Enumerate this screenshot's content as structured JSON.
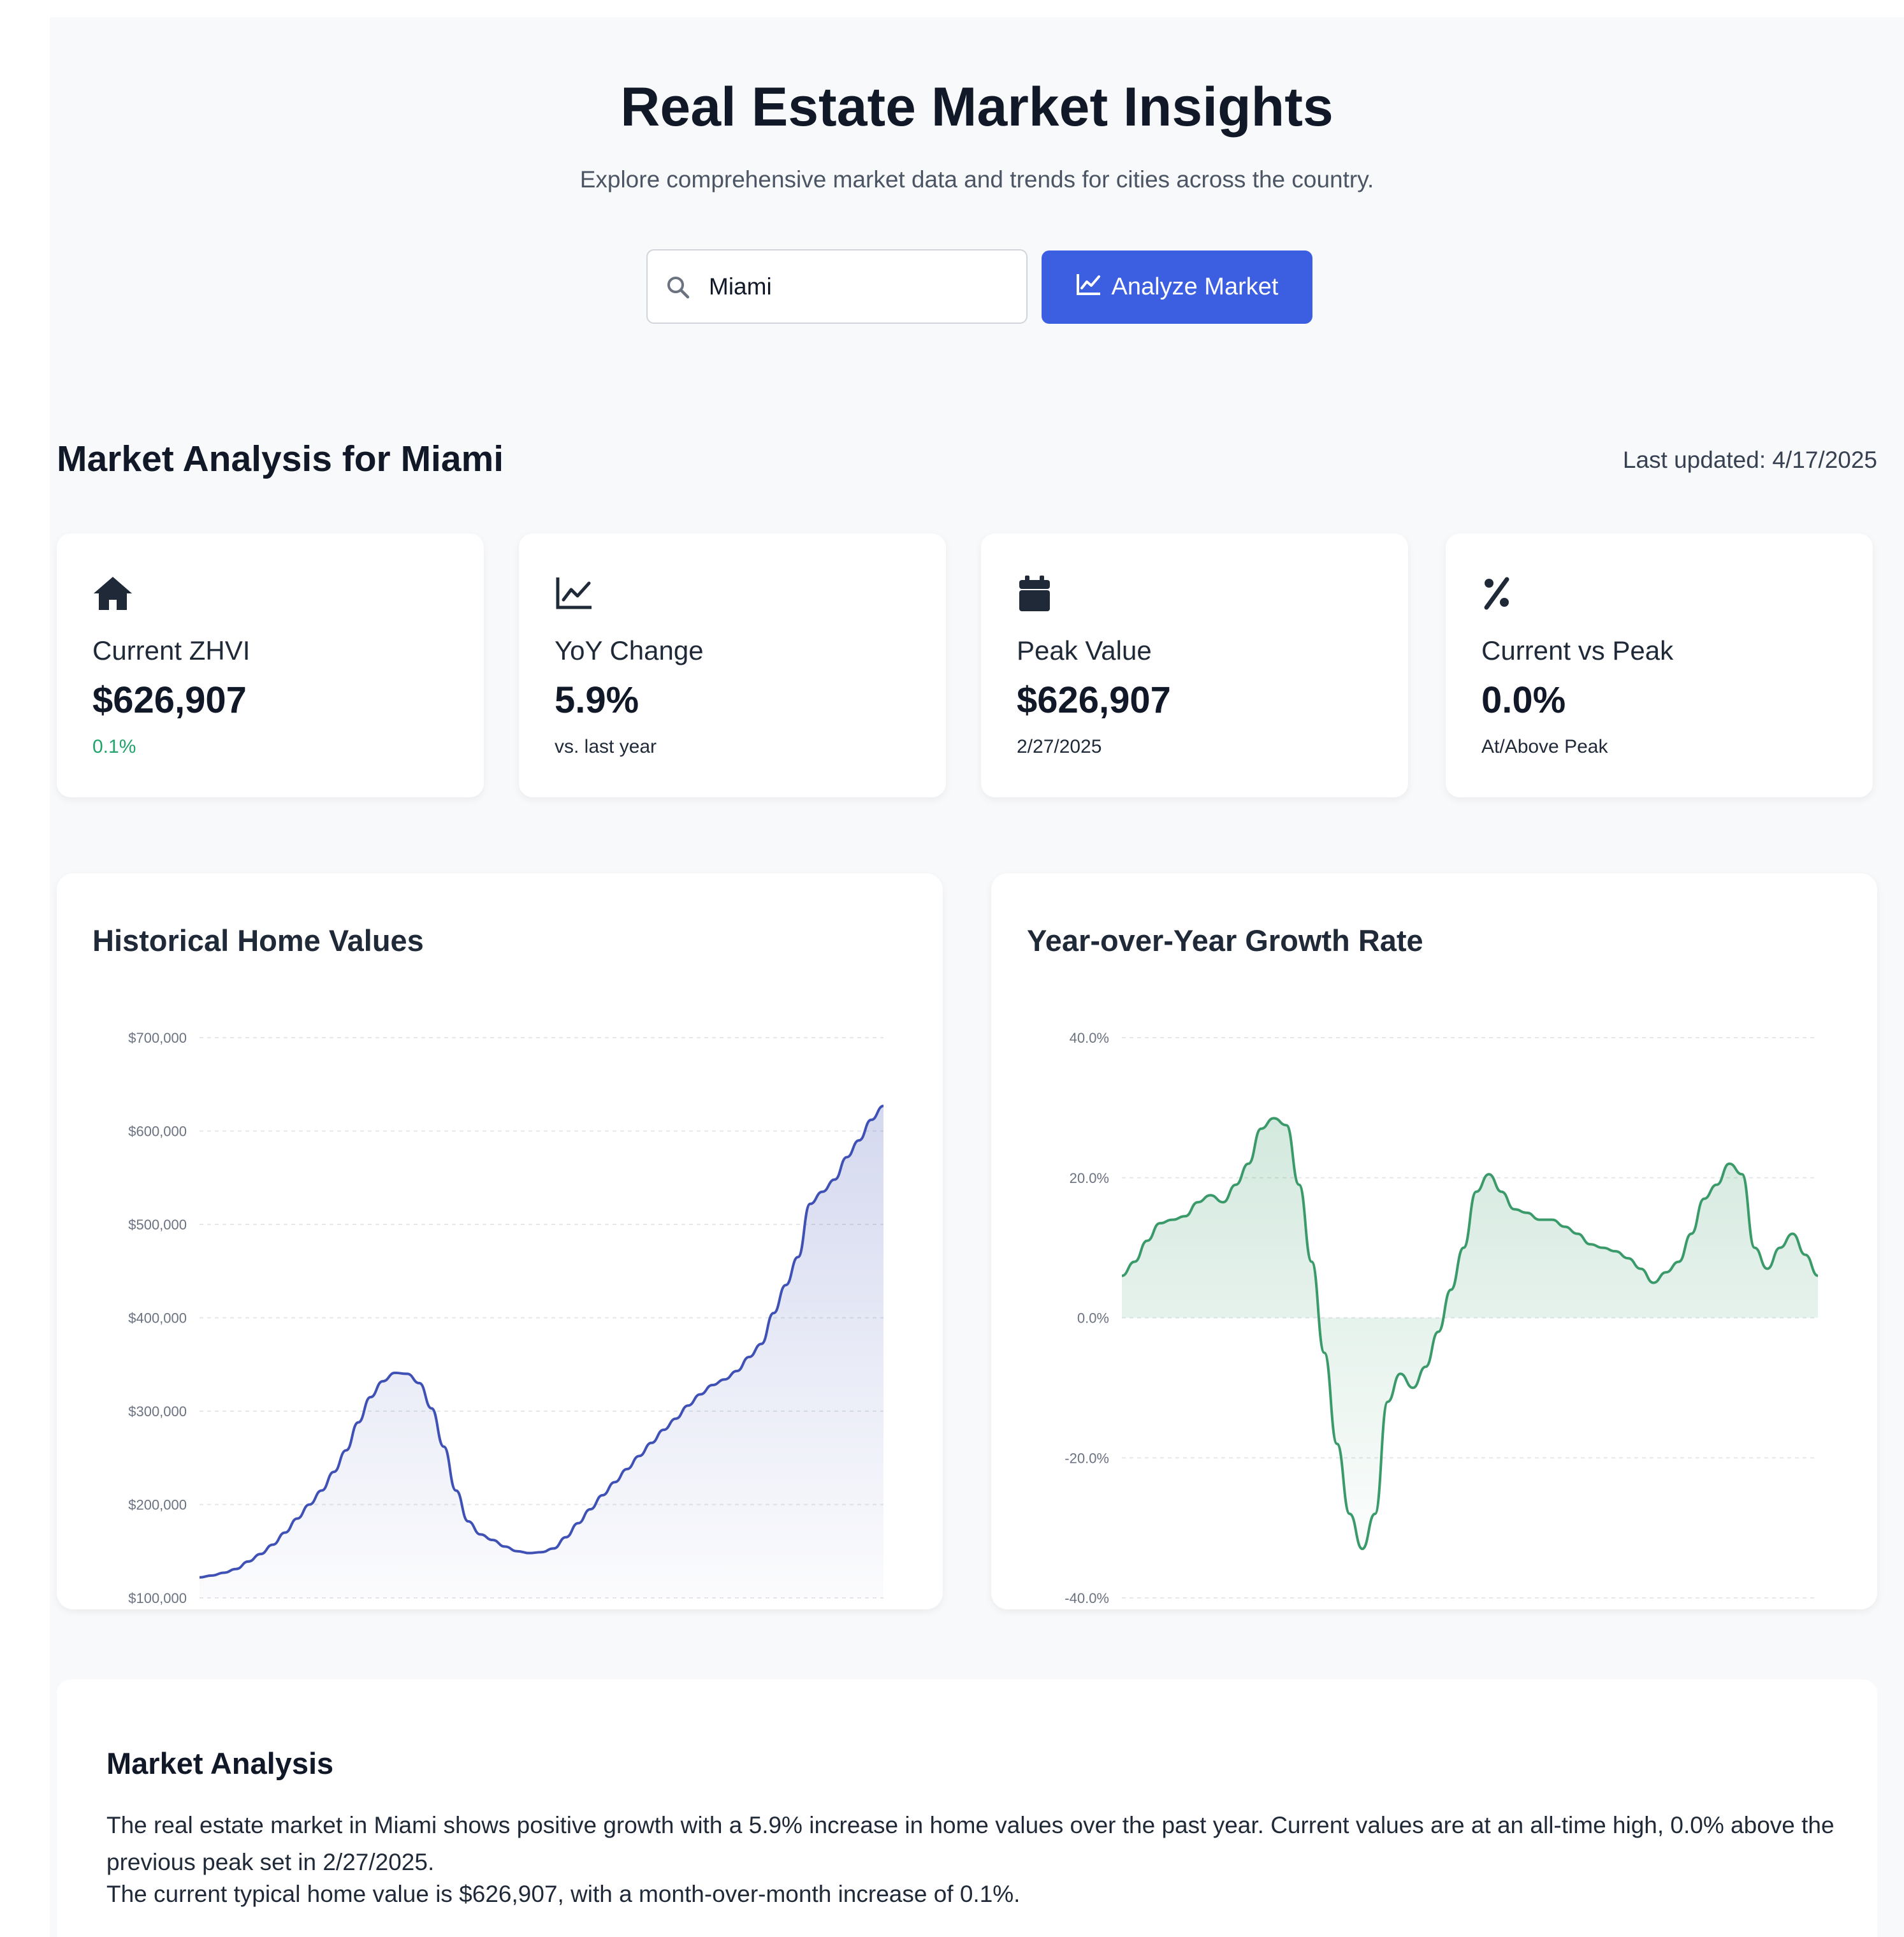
{
  "header": {
    "title": "Real Estate Market Insights",
    "subtitle": "Explore comprehensive market data and trends for cities across the country."
  },
  "search": {
    "value": "Miami",
    "icon": "search-icon",
    "button_label": "Analyze Market",
    "button_icon": "line-chart-icon",
    "accent_color": "#3b5fe0"
  },
  "analysis_header": {
    "title": "Market Analysis for Miami",
    "last_updated": "Last updated: 4/17/2025"
  },
  "stats": [
    {
      "icon": "home-icon",
      "label": "Current ZHVI",
      "value": "$626,907",
      "sub": "0.1%",
      "sub_color": "#22a36b"
    },
    {
      "icon": "line-chart-icon",
      "label": "YoY Change",
      "value": "5.9%",
      "sub": "vs. last year"
    },
    {
      "icon": "calendar-icon",
      "label": "Peak Value",
      "value": "$626,907",
      "sub": "2/27/2025"
    },
    {
      "icon": "percent-icon",
      "label": "Current vs Peak",
      "value": "0.0%",
      "sub": "At/Above Peak"
    }
  ],
  "charts": {
    "historical_title": "Historical Home Values",
    "growth_title": "Year-over-Year Growth Rate"
  },
  "chart_data": [
    {
      "type": "area",
      "title": "Historical Home Values",
      "ylim": [
        100000,
        700000
      ],
      "yticks": [
        "$100,000",
        "$200,000",
        "$300,000",
        "$400,000",
        "$500,000",
        "$600,000",
        "$700,000"
      ],
      "grid": true,
      "color": "#3f51b5",
      "values": [
        122000,
        124000,
        127000,
        131000,
        139000,
        147000,
        157000,
        170000,
        185000,
        200000,
        215000,
        235000,
        258000,
        288000,
        315000,
        332000,
        341000,
        340000,
        330000,
        303000,
        262000,
        215000,
        182000,
        168000,
        162000,
        155000,
        150000,
        148000,
        149000,
        153000,
        165000,
        180000,
        195000,
        210000,
        224000,
        238000,
        252000,
        266000,
        280000,
        292000,
        306000,
        318000,
        328000,
        334000,
        343000,
        358000,
        372000,
        405000,
        435000,
        465000,
        522000,
        535000,
        548000,
        572000,
        590000,
        612000,
        626907
      ]
    },
    {
      "type": "area",
      "title": "Year-over-Year Growth Rate",
      "ylim": [
        -40,
        40
      ],
      "yticks": [
        "-40.0%",
        "-20.0%",
        "0.0%",
        "20.0%",
        "40.0%"
      ],
      "grid": true,
      "color": "#3a9a6a",
      "values": [
        6,
        8,
        11,
        13.5,
        14,
        14.5,
        16.5,
        17.5,
        16.5,
        19,
        22,
        27,
        28.5,
        27.5,
        19,
        8,
        -5,
        -18,
        -28,
        -33,
        -28,
        -12,
        -8,
        -10,
        -7,
        -2,
        4,
        10,
        18,
        20.5,
        18,
        15.5,
        15,
        14,
        14,
        13,
        12,
        10.5,
        10,
        9.5,
        8.5,
        7,
        5,
        6.5,
        8,
        12,
        17,
        19,
        22,
        20.5,
        10,
        7,
        10,
        12,
        9,
        6
      ]
    }
  ],
  "analysis": {
    "title": "Market Analysis",
    "paragraph1": "The real estate market in Miami shows positive growth with a 5.9% increase in home values over the past year. Current values are at an all-time high, 0.0% above the previous peak set in 2/27/2025.",
    "paragraph2": "The current typical home value is $626,907, with a month-over-month increase of 0.1%."
  }
}
